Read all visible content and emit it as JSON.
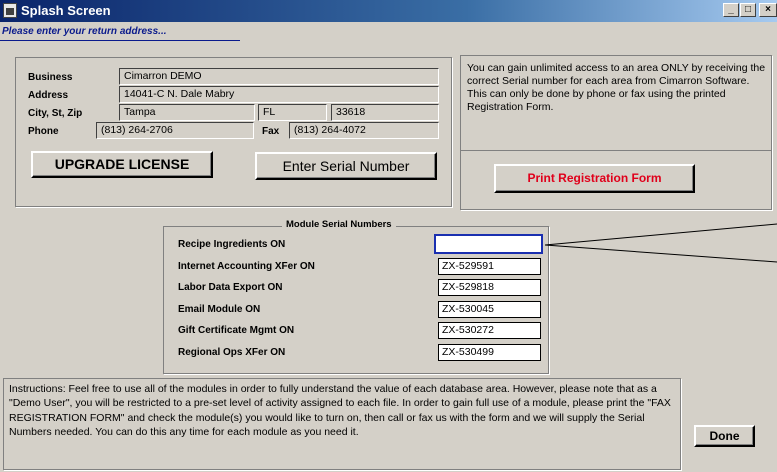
{
  "window": {
    "title": "Splash Screen",
    "controls": {
      "minimize": "_",
      "maximize": "□",
      "close": "×"
    }
  },
  "subtitle": "Please enter your return address...",
  "address": {
    "business_label": "Business",
    "business_value": "Cimarron DEMO",
    "address_label": "Address",
    "address_value": "14041-C N. Dale Mabry",
    "city_label": "City, St, Zip",
    "city_value": "Tampa",
    "state_value": "FL",
    "zip_value": "33618",
    "phone_label": "Phone",
    "phone_value": "(813) 264-2706",
    "fax_label": "Fax",
    "fax_value": "(813) 264-4072"
  },
  "buttons": {
    "upgrade": "UPGRADE LICENSE",
    "enter_serial": "Enter Serial Number",
    "print_form": "Print Registration Form",
    "done": "Done"
  },
  "info_text": "You can gain unlimited access to an area ONLY by receiving the correct Serial number for each area from Cimarron Software. This can only be done by phone or fax using the printed Registration Form.",
  "modules": {
    "title": "Module Serial Numbers",
    "items": [
      {
        "label": "Recipe Ingredients ON",
        "serial": ""
      },
      {
        "label": "Internet Accounting XFer ON",
        "serial": "ZX-529591"
      },
      {
        "label": "Labor Data Export ON",
        "serial": "ZX-529818"
      },
      {
        "label": "Email Module ON",
        "serial": "ZX-530045"
      },
      {
        "label": "Gift Certificate Mgmt ON",
        "serial": "ZX-530272"
      },
      {
        "label": "Regional Ops XFer ON",
        "serial": "ZX-530499"
      }
    ]
  },
  "instructions": "Instructions: Feel free to use all of the modules in order to fully understand the value of each database area. However, please note that as a \"Demo User\", you will be restricted to a pre-set level of activity assigned to each file. In order to gain full use of a module, please print the \"FAX REGISTRATION FORM\" and check the module(s) you would like to turn on, then call or fax us with the form and we will supply the Serial Numbers needed. You can do this any time for each module as you need it.",
  "colors": {
    "title_bar": "#0a246a",
    "subtitle": "#0a1a8c",
    "print_button_text": "#e0001b",
    "focus_border": "#1a2fb0"
  }
}
